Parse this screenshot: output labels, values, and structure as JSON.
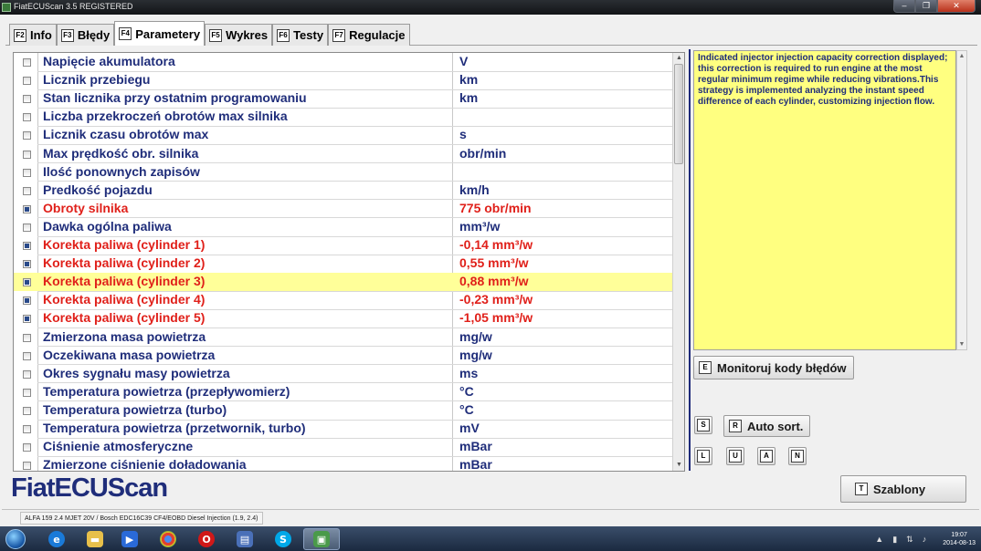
{
  "window": {
    "title": "FiatECUScan 3.5 REGISTERED"
  },
  "tabs": [
    {
      "key": "F2",
      "label": "Info"
    },
    {
      "key": "F3",
      "label": "Błędy"
    },
    {
      "key": "F4",
      "label": "Parametery"
    },
    {
      "key": "F5",
      "label": "Wykres"
    },
    {
      "key": "F6",
      "label": "Testy"
    },
    {
      "key": "F7",
      "label": "Regulacje"
    }
  ],
  "active_tab": "Parametery",
  "parameters": [
    {
      "name": "Napięcie akumulatora",
      "value": "V",
      "checked": false,
      "highlight": false,
      "red": false
    },
    {
      "name": "Licznik przebiegu",
      "value": "km",
      "checked": false,
      "highlight": false,
      "red": false
    },
    {
      "name": "Stan licznika przy ostatnim programowaniu",
      "value": "km",
      "checked": false,
      "highlight": false,
      "red": false
    },
    {
      "name": "Liczba przekroczeń obrotów max silnika",
      "value": "",
      "checked": false,
      "highlight": false,
      "red": false
    },
    {
      "name": "Licznik czasu obrotów max",
      "value": "s",
      "checked": false,
      "highlight": false,
      "red": false
    },
    {
      "name": "Max prędkość obr. silnika",
      "value": "obr/min",
      "checked": false,
      "highlight": false,
      "red": false
    },
    {
      "name": "Ilość ponownych zapisów",
      "value": "",
      "checked": false,
      "highlight": false,
      "red": false
    },
    {
      "name": "Predkość pojazdu",
      "value": "km/h",
      "checked": false,
      "highlight": false,
      "red": false
    },
    {
      "name": "Obroty silnika",
      "value": "775 obr/min",
      "checked": true,
      "highlight": false,
      "red": true
    },
    {
      "name": "Dawka ogólna paliwa",
      "value": "mm³/w",
      "checked": false,
      "highlight": false,
      "red": false
    },
    {
      "name": "Korekta paliwa (cylinder 1)",
      "value": "-0,14 mm³/w",
      "checked": true,
      "highlight": false,
      "red": true
    },
    {
      "name": "Korekta paliwa (cylinder 2)",
      "value": "0,55 mm³/w",
      "checked": true,
      "highlight": false,
      "red": true
    },
    {
      "name": "Korekta paliwa (cylinder 3)",
      "value": "0,88 mm³/w",
      "checked": true,
      "highlight": true,
      "red": true
    },
    {
      "name": "Korekta paliwa (cylinder 4)",
      "value": "-0,23 mm³/w",
      "checked": true,
      "highlight": false,
      "red": true
    },
    {
      "name": "Korekta paliwa (cylinder 5)",
      "value": "-1,05 mm³/w",
      "checked": true,
      "highlight": false,
      "red": true
    },
    {
      "name": "Zmierzona masa powietrza",
      "value": "mg/w",
      "checked": false,
      "highlight": false,
      "red": false
    },
    {
      "name": "Oczekiwana masa powietrza",
      "value": "mg/w",
      "checked": false,
      "highlight": false,
      "red": false
    },
    {
      "name": "Okres sygnału masy powietrza",
      "value": "ms",
      "checked": false,
      "highlight": false,
      "red": false
    },
    {
      "name": "Temperatura powietrza (przepływomierz)",
      "value": "°C",
      "checked": false,
      "highlight": false,
      "red": false
    },
    {
      "name": "Temperatura powietrza (turbo)",
      "value": "°C",
      "checked": false,
      "highlight": false,
      "red": false
    },
    {
      "name": "Temperatura powietrza (przetwornik, turbo)",
      "value": "mV",
      "checked": false,
      "highlight": false,
      "red": false
    },
    {
      "name": "Ciśnienie atmosferyczne",
      "value": "mBar",
      "checked": false,
      "highlight": false,
      "red": false
    },
    {
      "name": "Zmierzone ciśnienie doładowania",
      "value": "mBar",
      "checked": false,
      "highlight": false,
      "red": false
    }
  ],
  "description": "Indicated injector injection capacity correction displayed; this correction is required to run engine at the most regular minimum regime while reducing vibrations.This strategy is implemented analyzing the instant speed difference of each cylinder, customizing injection flow.",
  "buttons": {
    "monitor": {
      "key": "E",
      "label": "Monitoruj kody błędów"
    },
    "s": {
      "key": "S"
    },
    "autosort": {
      "key": "R",
      "label": "Auto sort."
    },
    "l": {
      "key": "L"
    },
    "u": {
      "key": "U"
    },
    "a": {
      "key": "A"
    },
    "n": {
      "key": "N"
    },
    "templates": {
      "key": "T",
      "label": "Szablony"
    }
  },
  "logo": "FiatECUScan",
  "status": "ALFA 159 2.4 MJET 20V / Bosch EDC16C39 CF4/EOBD Diesel Injection (1.9, 2.4)",
  "clock": {
    "time": "19:07",
    "date": "2014-08-13"
  },
  "taskbar": {
    "icons": [
      "start-orb-icon",
      "internet-explorer-icon",
      "file-explorer-icon",
      "media-player-icon",
      "chrome-icon",
      "opera-icon",
      "program-icon",
      "skype-icon",
      "fiatecuscan-icon"
    ]
  },
  "colors": {
    "label_blue": "#1f2d7a",
    "active_red": "#e0201a",
    "highlight": "#ffff99",
    "desc_bg": "#ffff80"
  }
}
